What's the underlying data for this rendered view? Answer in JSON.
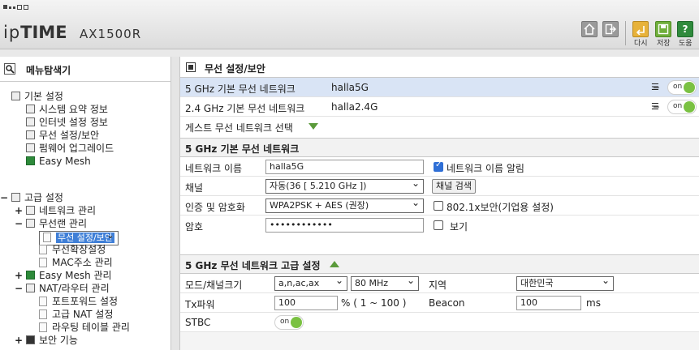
{
  "header": {
    "brand_ip": "ip",
    "brand_time": "TIME",
    "model": "AX1500R",
    "buttons": {
      "refresh": "다시",
      "save": "저장",
      "help": "도움"
    }
  },
  "nav": {
    "title": "메뉴탐색기",
    "basic": {
      "label": "기본 설정",
      "items": [
        "시스템 요약 정보",
        "인터넷 설정 정보",
        "무선 설정/보안",
        "펌웨어 업그레이드",
        "Easy Mesh"
      ]
    },
    "advanced": {
      "label": "고급 설정",
      "network": "네트워크 관리",
      "wlan": "무선랜 관리",
      "wlan_items": [
        "무선 설정/보안",
        "무선확장설정",
        "MAC주소 관리"
      ],
      "easymesh": "Easy Mesh 관리",
      "nat": "NAT/라우터 관리",
      "nat_items": [
        "포트포워드 설정",
        "고급 NAT 설정",
        "라우팅 테이블 관리"
      ],
      "security": "보안 기능"
    }
  },
  "main": {
    "title": "무선 설정/보안",
    "networks": [
      {
        "label": "5 GHz 기본 무선 네트워크",
        "ssid": "halla5G",
        "toggle": "on"
      },
      {
        "label": "2.4 GHz 기본 무선 네트워크",
        "ssid": "halla2.4G",
        "toggle": "on"
      }
    ],
    "guest": "게스트 무선 네트워크 선택",
    "basic_section": {
      "title": "5 GHz 기본 무선 네트워크",
      "name_label": "네트워크 이름",
      "name_value": "halla5G",
      "broadcast_label": "네트워크 이름 알림",
      "channel_label": "채널",
      "channel_value": "자동(36 [ 5.210 GHz ])",
      "scan_button": "채널 검색",
      "auth_label": "인증 및 암호화",
      "auth_value": "WPA2PSK + AES (권장)",
      "enterprise_label": "802.1x보안(기업용 설정)",
      "pw_label": "암호",
      "pw_value": "••••••••••••",
      "show_label": "보기"
    },
    "adv_section": {
      "title": "5 GHz 무선 네트워크 고급 설정",
      "mode_label": "모드/채널크기",
      "mode_value": "a,n,ac,ax",
      "width_value": "80 MHz",
      "region_label": "지역",
      "region_value": "대한민국",
      "tx_label": "Tx파워",
      "tx_value": "100",
      "tx_unit": "% ( 1 ~ 100 )",
      "beacon_label": "Beacon",
      "beacon_value": "100",
      "beacon_unit": "ms",
      "stbc_label": "STBC",
      "stbc_toggle": "on"
    }
  }
}
